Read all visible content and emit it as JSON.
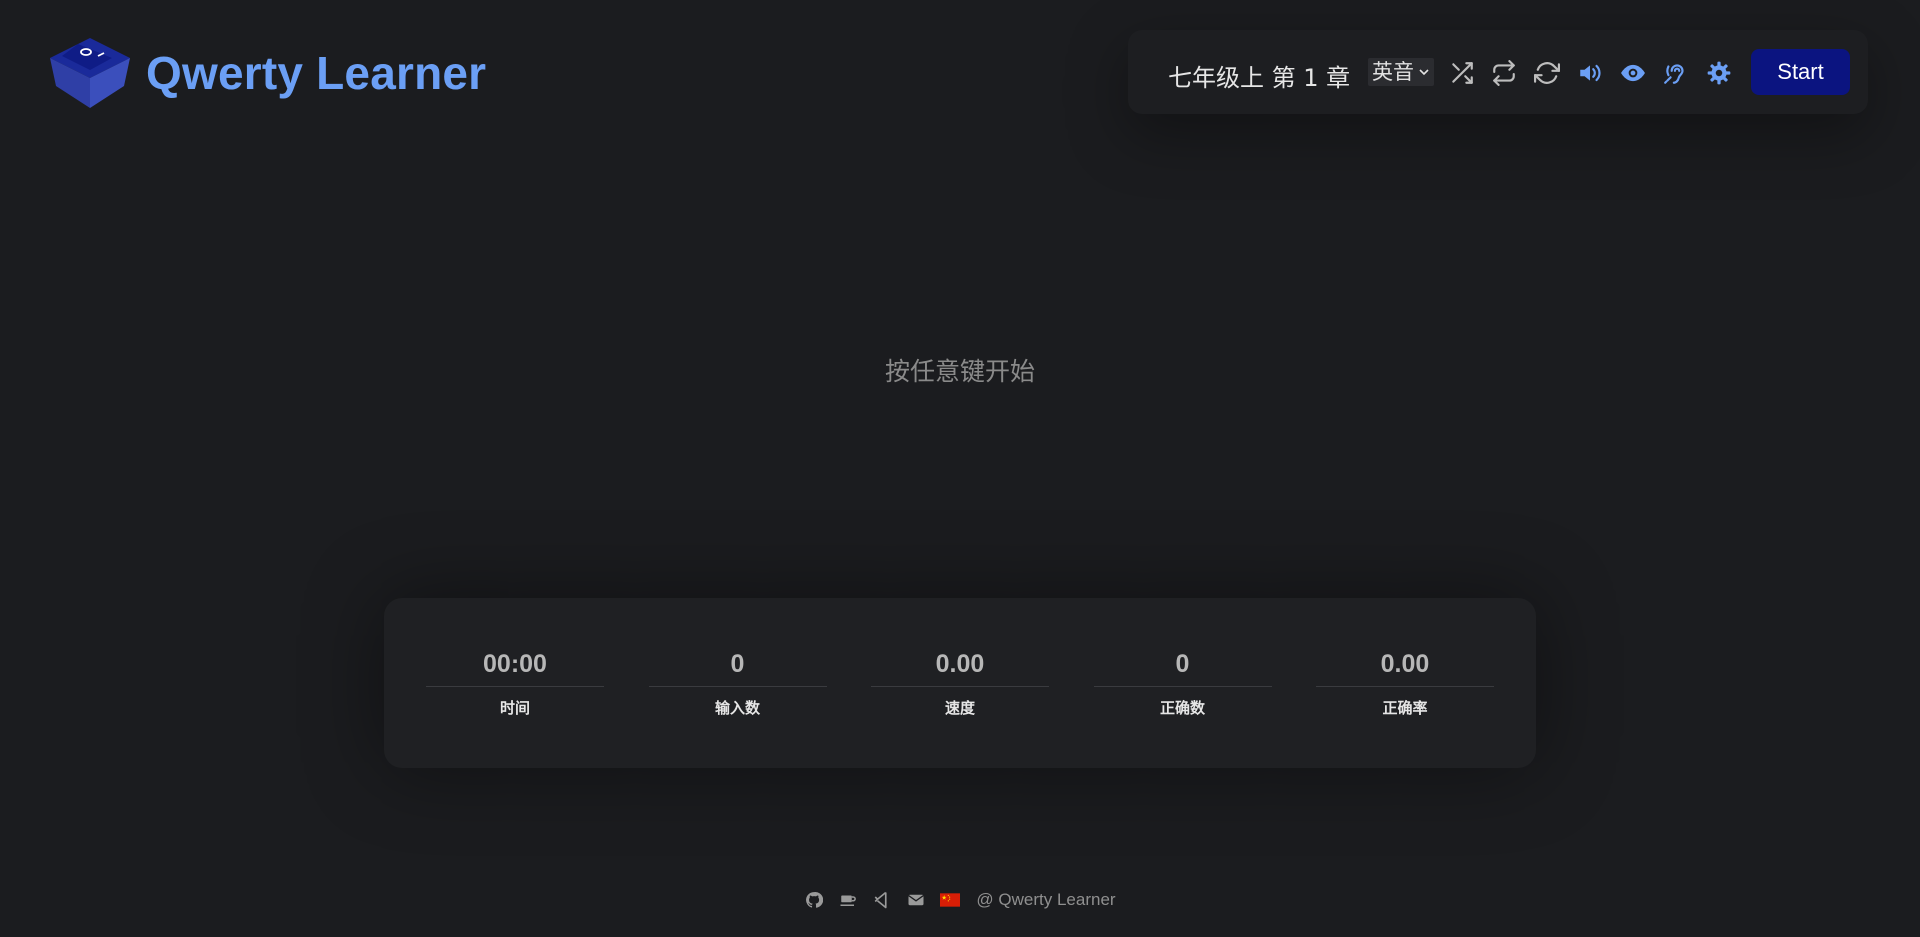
{
  "app": {
    "title": "Qwerty Learner"
  },
  "toolbar": {
    "dictionary_chapter": "七年级上 第 1 章",
    "pronunciation": "英音",
    "icons": [
      "shuffle-icon",
      "loop-icon",
      "repeat-icon",
      "volume-icon",
      "eye-icon",
      "hearing-icon",
      "settings-icon"
    ],
    "start_label": "Start",
    "colors": {
      "icon_default": "#bdbdbd",
      "icon_active": "#6b9ff5",
      "start_bg": "#0b1480"
    }
  },
  "main": {
    "prompt": "按任意键开始"
  },
  "stats": [
    {
      "value": "00:00",
      "label": "时间"
    },
    {
      "value": "0",
      "label": "输入数"
    },
    {
      "value": "0.00",
      "label": "速度"
    },
    {
      "value": "0",
      "label": "正确数"
    },
    {
      "value": "0.00",
      "label": "正确率"
    }
  ],
  "footer": {
    "icons": [
      "github-icon",
      "coffee-icon",
      "vscode-icon",
      "email-icon",
      "china-flag-icon"
    ],
    "credit": "@ Qwerty Learner"
  }
}
